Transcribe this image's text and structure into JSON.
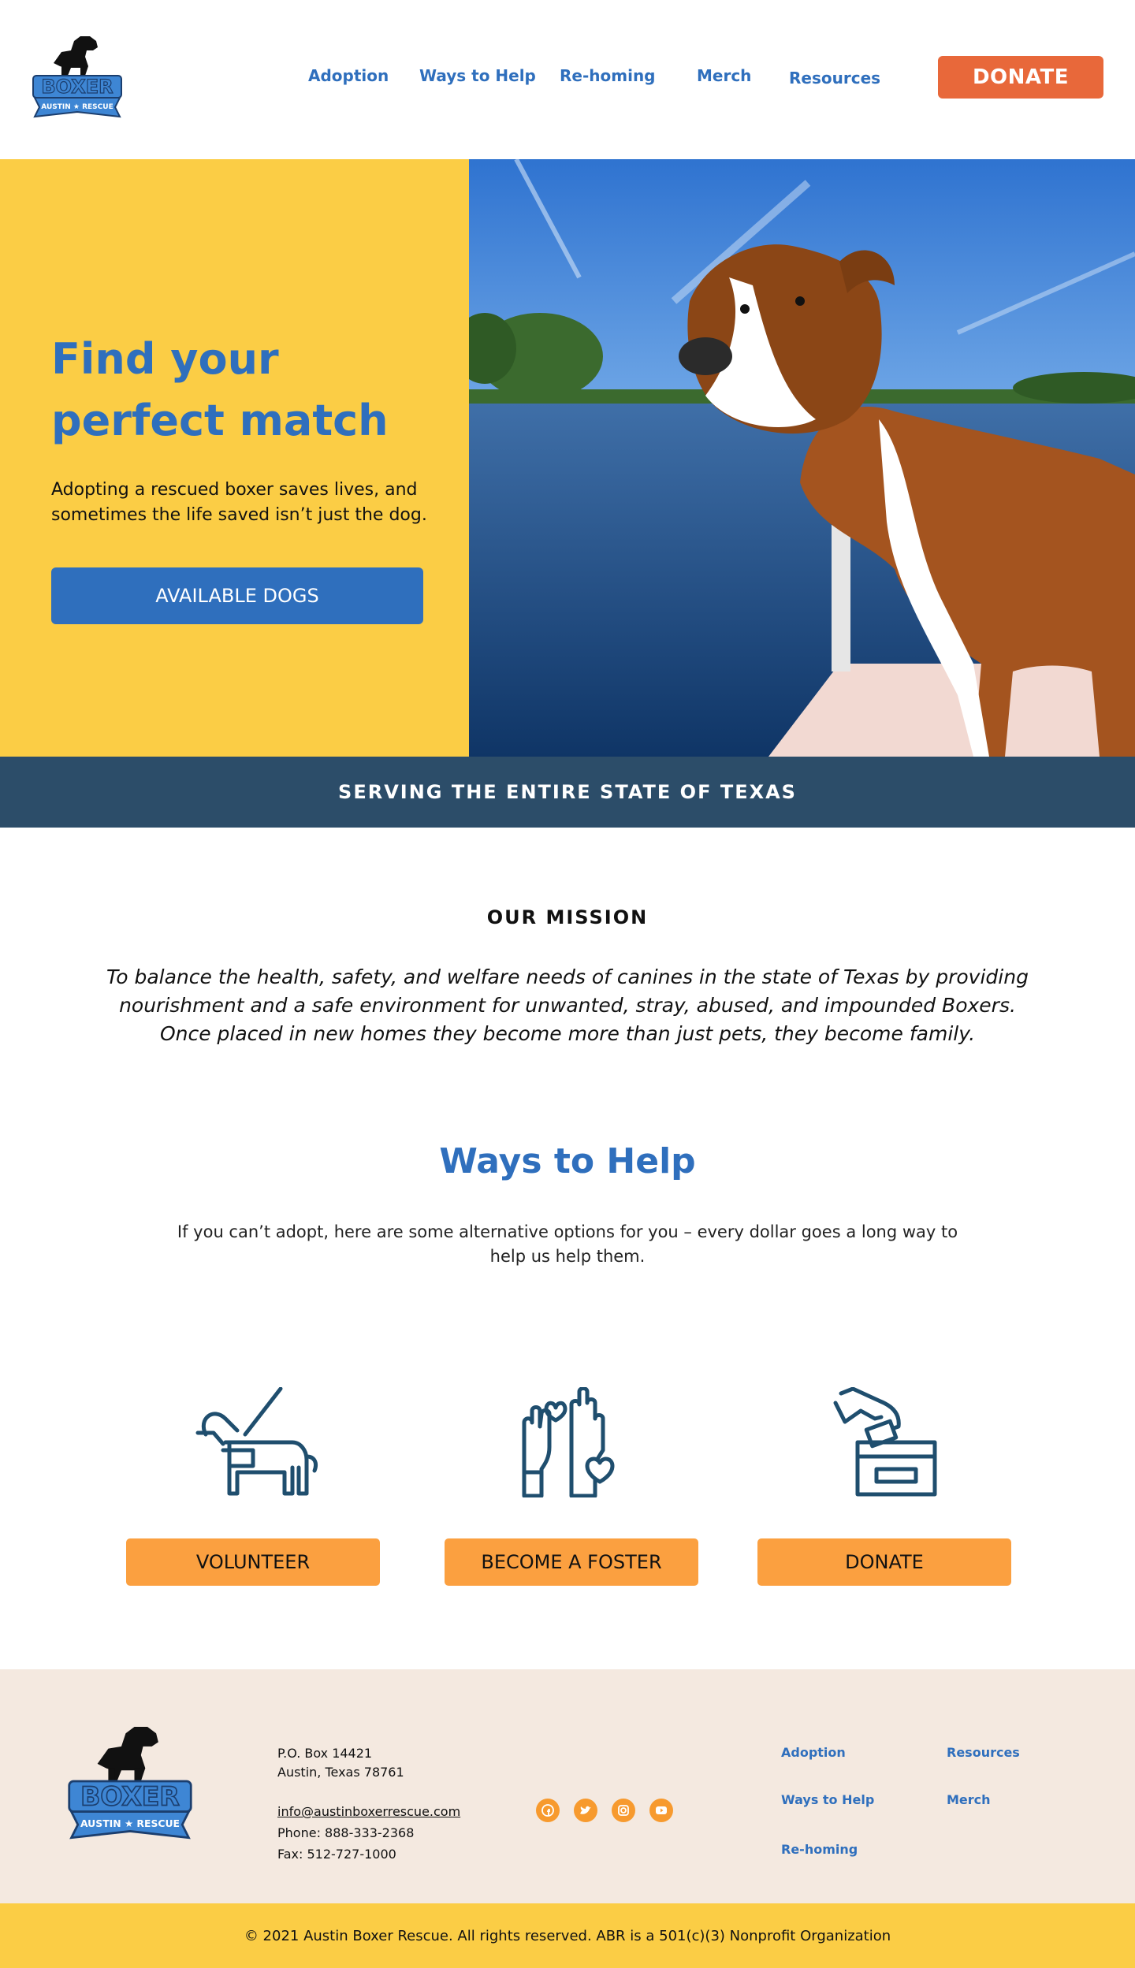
{
  "header": {
    "logo_text": "BOXER",
    "logo_subtext": "AUSTIN ★ RESCUE",
    "nav": [
      "Adoption",
      "Ways to Help",
      "Re-homing",
      "Merch",
      "Resources"
    ],
    "donate_label": "DONATE"
  },
  "hero": {
    "title": "Find your perfect match",
    "text": "Adopting a rescued boxer saves lives, and sometimes the life saved isn’t just the dog.",
    "button_label": "AVAILABLE DOGS"
  },
  "banner": {
    "text": "SERVING THE ENTIRE STATE OF TEXAS"
  },
  "mission": {
    "heading": "OUR MISSION",
    "text": "To balance the health, safety, and welfare needs of canines in the state of Texas by providing nourishment and a safe environment for unwanted, stray, abused, and impounded Boxers. Once placed in new homes they become more than just pets, they become family."
  },
  "ways": {
    "title": "Ways to Help",
    "text": "If you can’t adopt, here are some alternative options for you – every dollar goes a long way to help us help them.",
    "items": [
      {
        "icon": "service-dog-icon",
        "label": "VOLUNTEER"
      },
      {
        "icon": "raised-hands-heart-icon",
        "label": "BECOME A FOSTER"
      },
      {
        "icon": "donation-box-icon",
        "label": "DONATE"
      }
    ]
  },
  "footer": {
    "address_line1": "P.O. Box 14421",
    "address_line2": "Austin, Texas 78761",
    "email": "info@austinboxerrescue.com",
    "phone": "Phone: 888-333-2368",
    "fax": "Fax: 512-727-1000",
    "social": [
      "facebook-icon",
      "twitter-icon",
      "instagram-icon",
      "youtube-icon"
    ],
    "links": [
      "Adoption",
      "Resources",
      "Ways to Help",
      "Merch",
      "Re-homing"
    ],
    "copyright": "© 2021 Austin Boxer Rescue. All rights reserved. ABR is a 501(c)(3) Nonprofit Organization"
  },
  "colors": {
    "brand_blue": "#2f6fbd",
    "yellow": "#fbcd45",
    "donate_orange": "#e8683a",
    "button_orange": "#fba040",
    "navy": "#2c4d69",
    "footer_bg": "#f4e9e0"
  }
}
